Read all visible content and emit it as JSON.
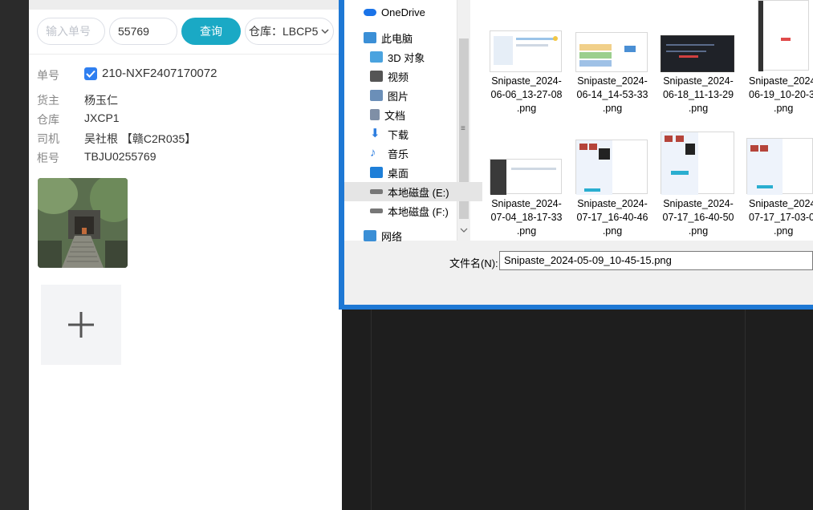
{
  "mobile": {
    "search": {
      "order_placeholder": "输入单号",
      "qty_value": "55769",
      "query_button": "查询",
      "warehouse_select": "仓库：LBCP5"
    },
    "order": {
      "label": "单号",
      "value": "210-NXF2407170072",
      "checked": true
    },
    "fields": [
      {
        "label": "货主",
        "value": "杨玉仁"
      },
      {
        "label": "仓库",
        "value": "JXCP1"
      },
      {
        "label": "司机",
        "value": "吴社根 【赣C2R035】"
      },
      {
        "label": "柜号",
        "value": "TBJU0255769"
      }
    ],
    "add_photo_glyph": "+"
  },
  "dialog": {
    "nav_items": [
      {
        "label": "OneDrive",
        "icon": "onedrive-icon",
        "color": "#1a73e8"
      },
      {
        "label": "此电脑",
        "icon": "pc-icon",
        "color": "#3b8fd6"
      },
      {
        "label": "3D 对象",
        "icon": "3d-objects-icon",
        "color": "#4aa3df"
      },
      {
        "label": "视频",
        "icon": "video-icon",
        "color": "#555555"
      },
      {
        "label": "图片",
        "icon": "pictures-icon",
        "color": "#6b8fb8"
      },
      {
        "label": "文档",
        "icon": "documents-icon",
        "color": "#7f8fa6"
      },
      {
        "label": "下载",
        "icon": "downloads-icon",
        "color": "#2f7fe0"
      },
      {
        "label": "音乐",
        "icon": "music-icon",
        "color": "#2f7fe0"
      },
      {
        "label": "桌面",
        "icon": "desktop-icon",
        "color": "#1e7fd8"
      },
      {
        "label": "本地磁盘 (E:)",
        "icon": "drive-icon",
        "color": "#777777"
      },
      {
        "label": "本地磁盘 (F:)",
        "icon": "drive-icon",
        "color": "#777777"
      },
      {
        "label": "网络",
        "icon": "network-icon",
        "color": "#3b8fd6"
      }
    ],
    "selected_nav": "本地磁盘 (E:)",
    "files": [
      {
        "line1": "Snipaste_2024-",
        "line2": "06-06_13-27-08",
        "line3": ".png"
      },
      {
        "line1": "Snipaste_2024-",
        "line2": "06-14_14-53-33",
        "line3": ".png"
      },
      {
        "line1": "Snipaste_2024-",
        "line2": "06-18_11-13-29",
        "line3": ".png"
      },
      {
        "line1": "Snipaste_2024",
        "line2": "06-19_10-20-3",
        "line3": ".png"
      },
      {
        "line1": "Snipaste_2024-",
        "line2": "07-04_18-17-33",
        "line3": ".png"
      },
      {
        "line1": "Snipaste_2024-",
        "line2": "07-17_16-40-46",
        "line3": ".png"
      },
      {
        "line1": "Snipaste_2024-",
        "line2": "07-17_16-40-50",
        "line3": ".png"
      },
      {
        "line1": "Snipaste_2024",
        "line2": "07-17_17-03-0",
        "line3": ".png"
      }
    ],
    "filename_label": "文件名(N):",
    "filename_value": "Snipaste_2024-05-09_10-45-15.png"
  }
}
